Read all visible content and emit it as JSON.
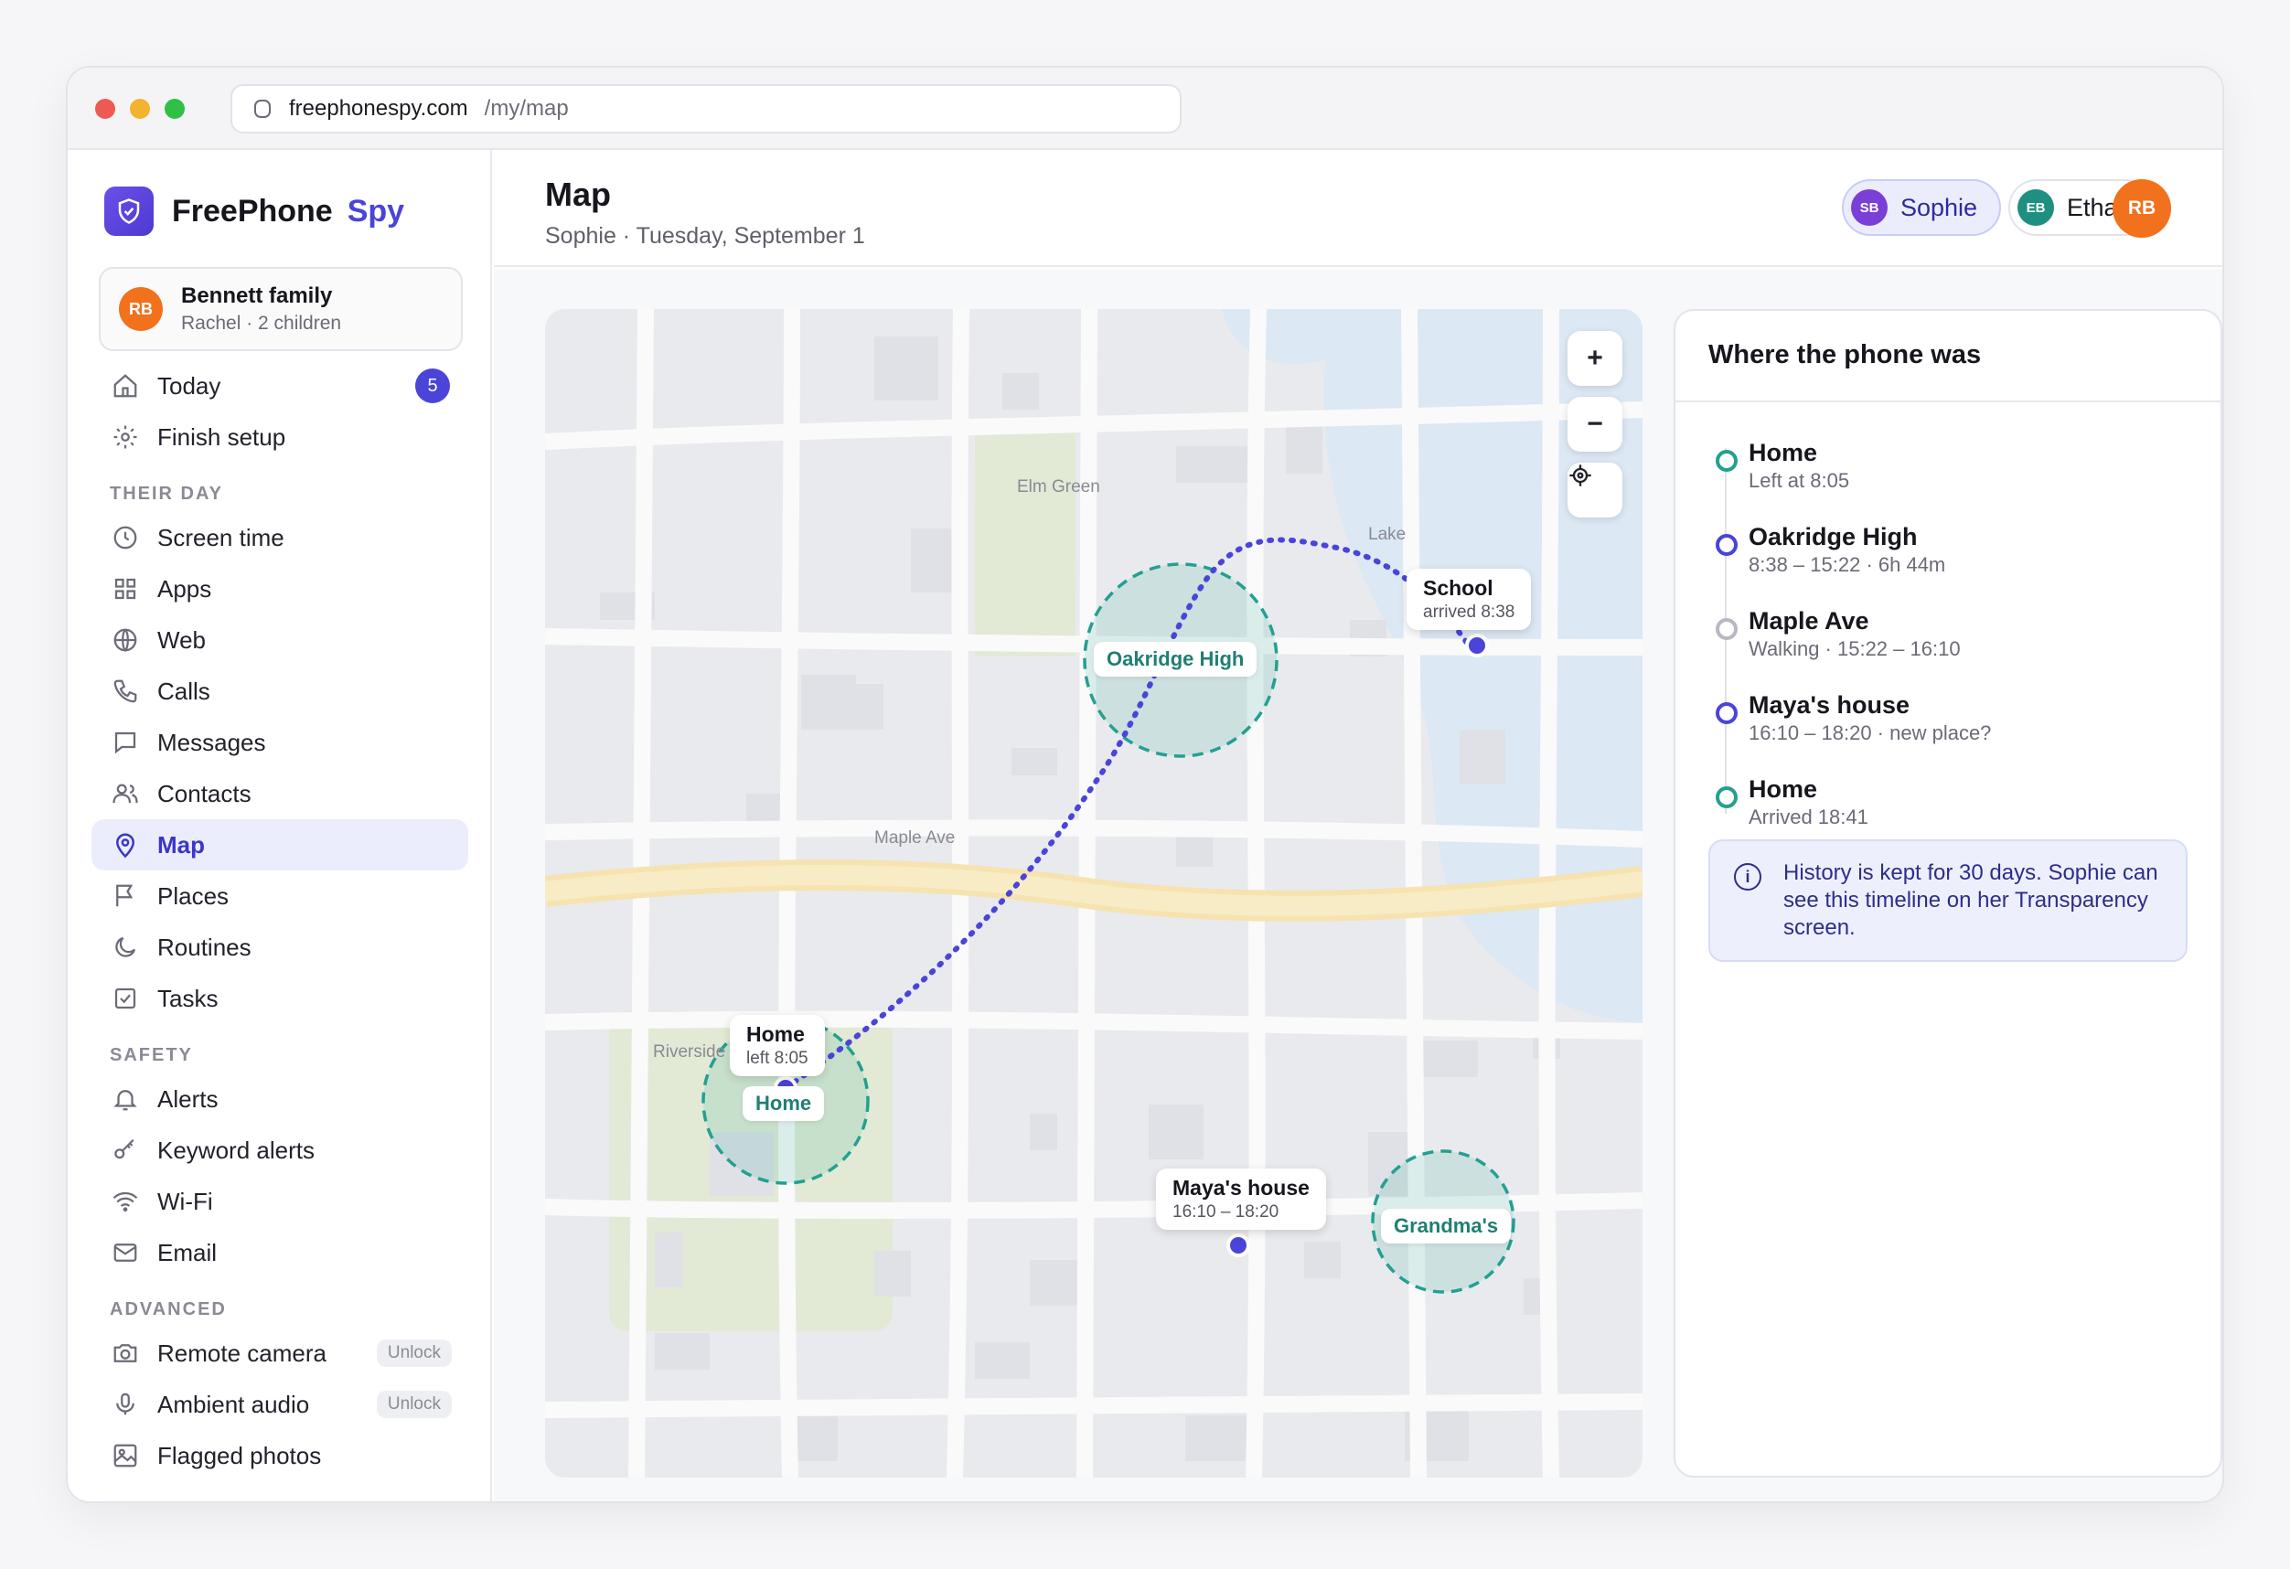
{
  "browser": {
    "host": "freephonespy.com",
    "path": "/my/map"
  },
  "brand": {
    "name": "FreePhone",
    "accent": "Spy"
  },
  "family": {
    "initials": "RB",
    "name": "Bennett family",
    "sub": "Rachel · 2 children"
  },
  "nav": {
    "today": {
      "label": "Today",
      "badge": "5"
    },
    "finish_setup": "Finish setup",
    "section_day": "THEIR DAY",
    "screen_time": "Screen time",
    "apps": "Apps",
    "web": "Web",
    "calls": "Calls",
    "messages": "Messages",
    "contacts": "Contacts",
    "map": "Map",
    "places": "Places",
    "routines": "Routines",
    "tasks": "Tasks",
    "section_safety": "SAFETY",
    "alerts": "Alerts",
    "keyword_alerts": "Keyword alerts",
    "wifi": "Wi-Fi",
    "email": "Email",
    "section_advanced": "ADVANCED",
    "remote_camera": {
      "label": "Remote camera",
      "tag": "Unlock"
    },
    "ambient_audio": {
      "label": "Ambient audio",
      "tag": "Unlock"
    },
    "flagged_photos": "Flagged photos"
  },
  "header": {
    "title": "Map",
    "subtitle": "Sophie · Tuesday, September 1",
    "kids": [
      {
        "initials": "SB",
        "name": "Sophie",
        "color": "#7a3fd6",
        "selected": true
      },
      {
        "initials": "EB",
        "name": "Ethan",
        "color": "#1f8f82",
        "selected": false
      }
    ],
    "me": "RB"
  },
  "map": {
    "zoom_in": "+",
    "zoom_out": "−",
    "street_labels": {
      "elm_green": "Elm Green",
      "lake": "Lake",
      "maple_ave": "Maple Ave",
      "riverside": "Riverside"
    },
    "place_labels": {
      "oakridge": "Oakridge High",
      "home": "Home",
      "grandmas": "Grandma's"
    },
    "tips": {
      "school": {
        "title": "School",
        "sub": "arrived 8:38"
      },
      "home": {
        "title": "Home",
        "sub": "left 8:05"
      },
      "maya": {
        "title": "Maya's house",
        "sub": "16:10 – 18:20"
      }
    }
  },
  "timeline": {
    "title": "Where the phone was",
    "items": [
      {
        "title": "Home",
        "sub": "Left at 8:05",
        "color": "#23a090"
      },
      {
        "title": "Oakridge High",
        "sub": "8:38 – 15:22 · 6h 44m",
        "color": "#4a44d8"
      },
      {
        "title": "Maple Ave",
        "sub": "Walking · 15:22 – 16:10",
        "color": "#b7b8c2"
      },
      {
        "title": "Maya's house",
        "sub": "16:10 – 18:20 · new place?",
        "color": "#4a44d8"
      },
      {
        "title": "Home",
        "sub": "Arrived 18:41",
        "color": "#23a090"
      }
    ],
    "note": "History is kept for 30 days. Sophie can see this timeline on her Transparency screen."
  }
}
